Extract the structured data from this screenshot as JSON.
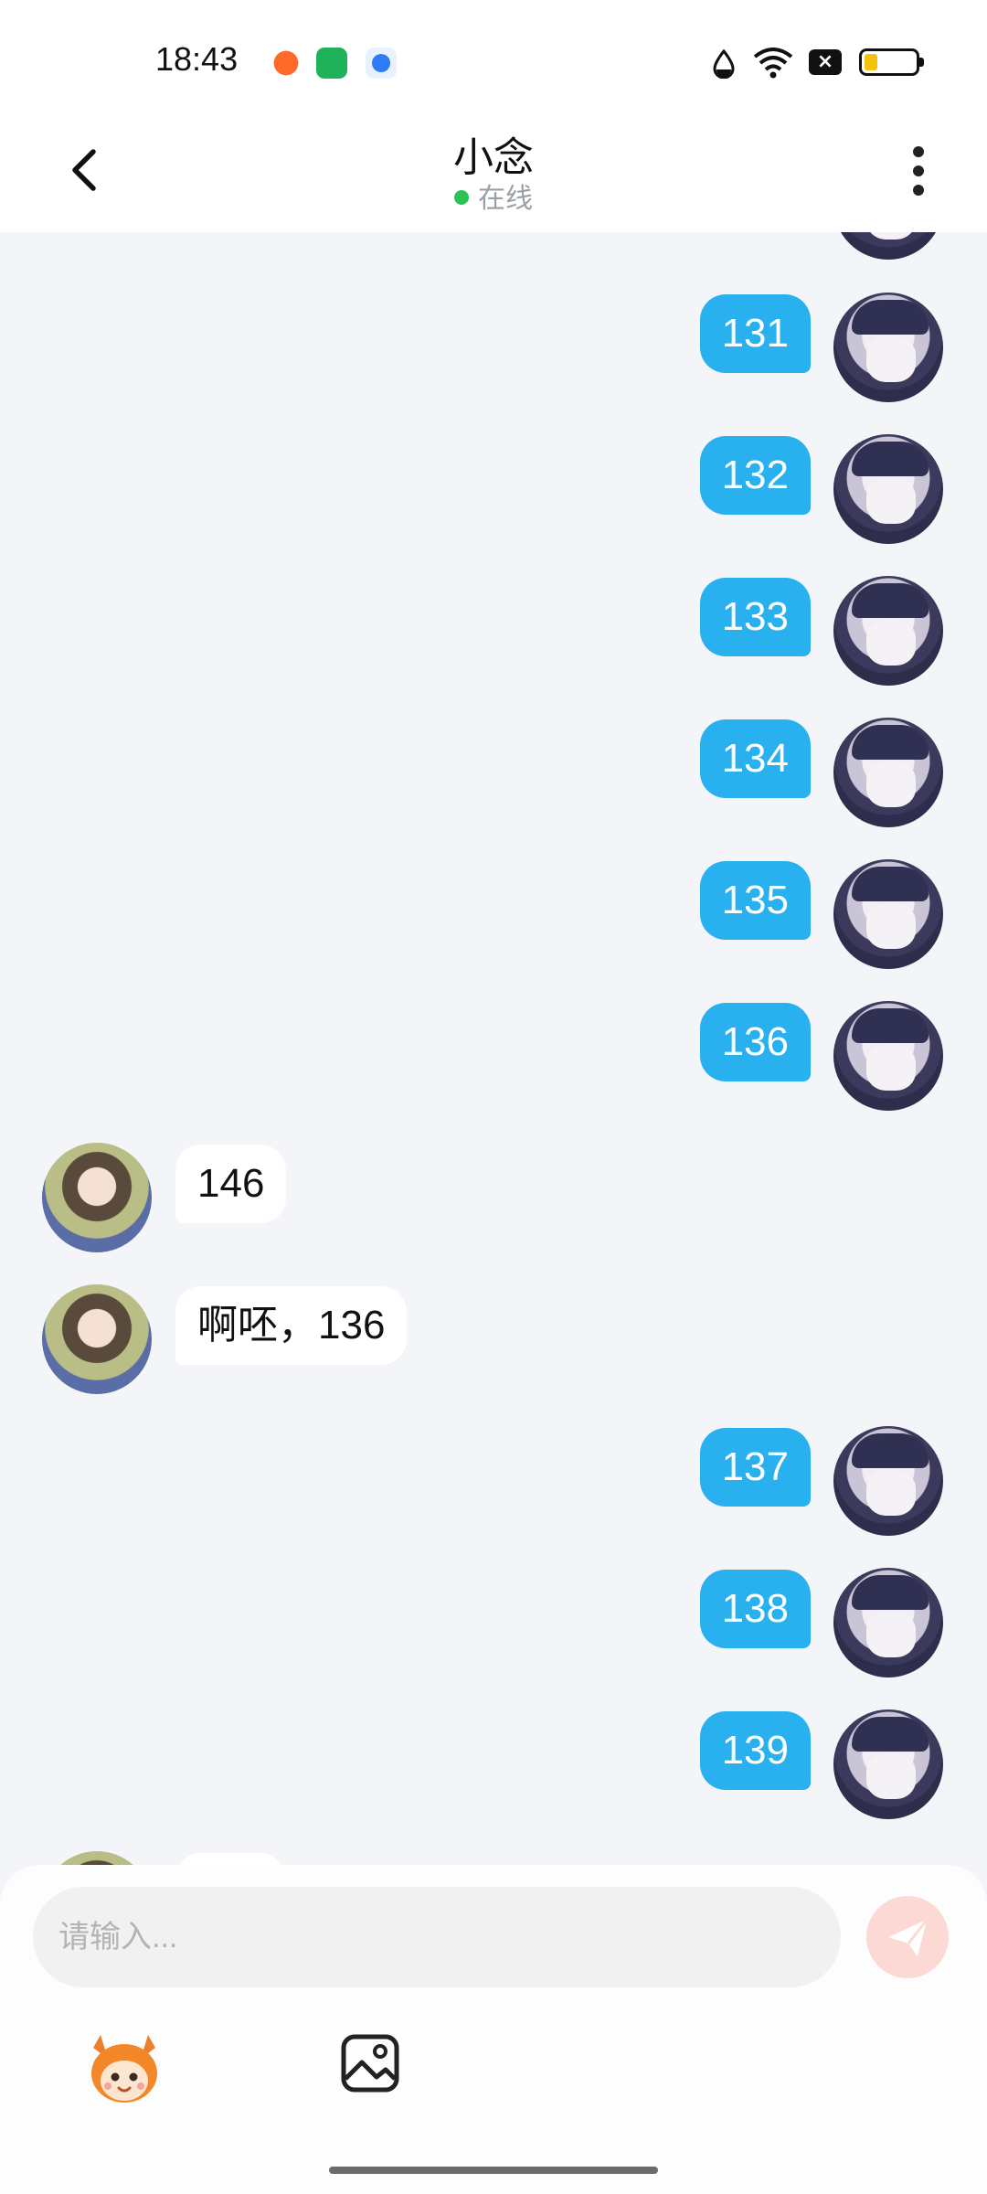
{
  "status_bar": {
    "time": "18:43"
  },
  "header": {
    "title": "小念",
    "status": "在线"
  },
  "messages": [
    {
      "side": "right",
      "text": "131"
    },
    {
      "side": "right",
      "text": "132"
    },
    {
      "side": "right",
      "text": "133"
    },
    {
      "side": "right",
      "text": "134"
    },
    {
      "side": "right",
      "text": "135"
    },
    {
      "side": "right",
      "text": "136"
    },
    {
      "side": "left",
      "text": "146"
    },
    {
      "side": "left",
      "text": "啊呸，136"
    },
    {
      "side": "right",
      "text": "137"
    },
    {
      "side": "right",
      "text": "138"
    },
    {
      "side": "right",
      "text": "139"
    }
  ],
  "input": {
    "placeholder": "请输入..."
  },
  "colors": {
    "bubble_right": "#29b1ef",
    "bubble_left": "#ffffff",
    "online_dot": "#2bc256",
    "send_button": "#fdd9d6",
    "background": "#f3f5f8"
  },
  "icons": [
    "back-arrow-icon",
    "more-vertical-icon",
    "send-icon",
    "emoji-mascot-icon",
    "image-icon",
    "wifi-icon",
    "water-drop-icon",
    "battery-icon"
  ]
}
